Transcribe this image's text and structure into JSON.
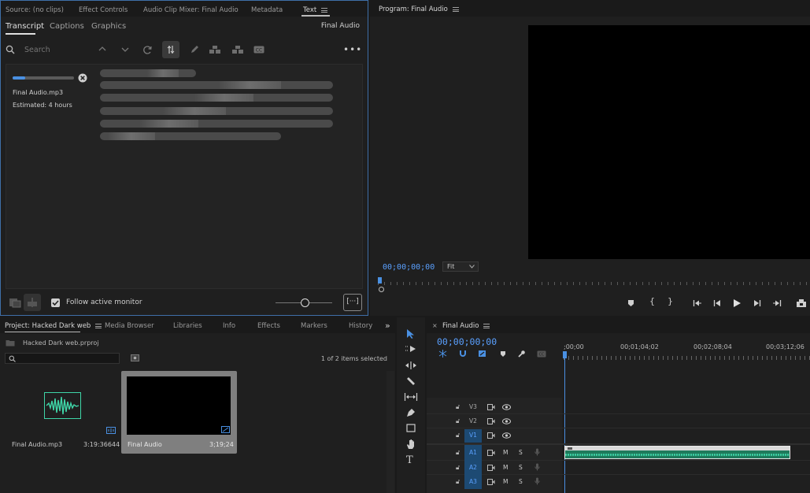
{
  "source_panel": {
    "tabs": [
      "Source: (no clips)",
      "Effect Controls",
      "Audio Clip Mixer: Final Audio",
      "Metadata",
      "Text"
    ],
    "active_tab": "Text",
    "sub_tabs": [
      "Transcript",
      "Captions",
      "Graphics"
    ],
    "active_sub_tab": "Transcript",
    "sequence_name": "Final Audio",
    "search_placeholder": "Search",
    "transcribe": {
      "file": "Final Audio.mp3",
      "estimate": "Estimated: 4 hours",
      "progress": 0.2
    },
    "follow_label": "Follow active monitor",
    "follow_checked": true
  },
  "program_monitor": {
    "title": "Program: Final Audio",
    "timecode": "00;00;00;00",
    "fit": "Fit"
  },
  "project_panel": {
    "tabs": [
      "Project: Hacked Dark web",
      "Media Browser",
      "Libraries",
      "Info",
      "Effects",
      "Markers",
      "History"
    ],
    "project_file": "Hacked Dark web.prproj",
    "selection_status": "1 of 2 items selected",
    "items": [
      {
        "name": "Final Audio.mp3",
        "duration": "3:19:36644"
      },
      {
        "name": "Final Audio",
        "duration": "3;19;24"
      }
    ]
  },
  "timeline": {
    "title": "Final Audio",
    "timecode": "00;00;00;00",
    "ruler": [
      ";00;00",
      "00;01;04;02",
      "00;02;08;04",
      "00;03;12;06"
    ],
    "video_tracks": [
      "V3",
      "V2",
      "V1"
    ],
    "audio_tracks": [
      "A1",
      "A2",
      "A3"
    ],
    "m_label": "M",
    "s_label": "S"
  },
  "colors": {
    "accent": "#5aa0ff",
    "waveform": "#3fd6a8",
    "clip": "#1f7a5c"
  }
}
